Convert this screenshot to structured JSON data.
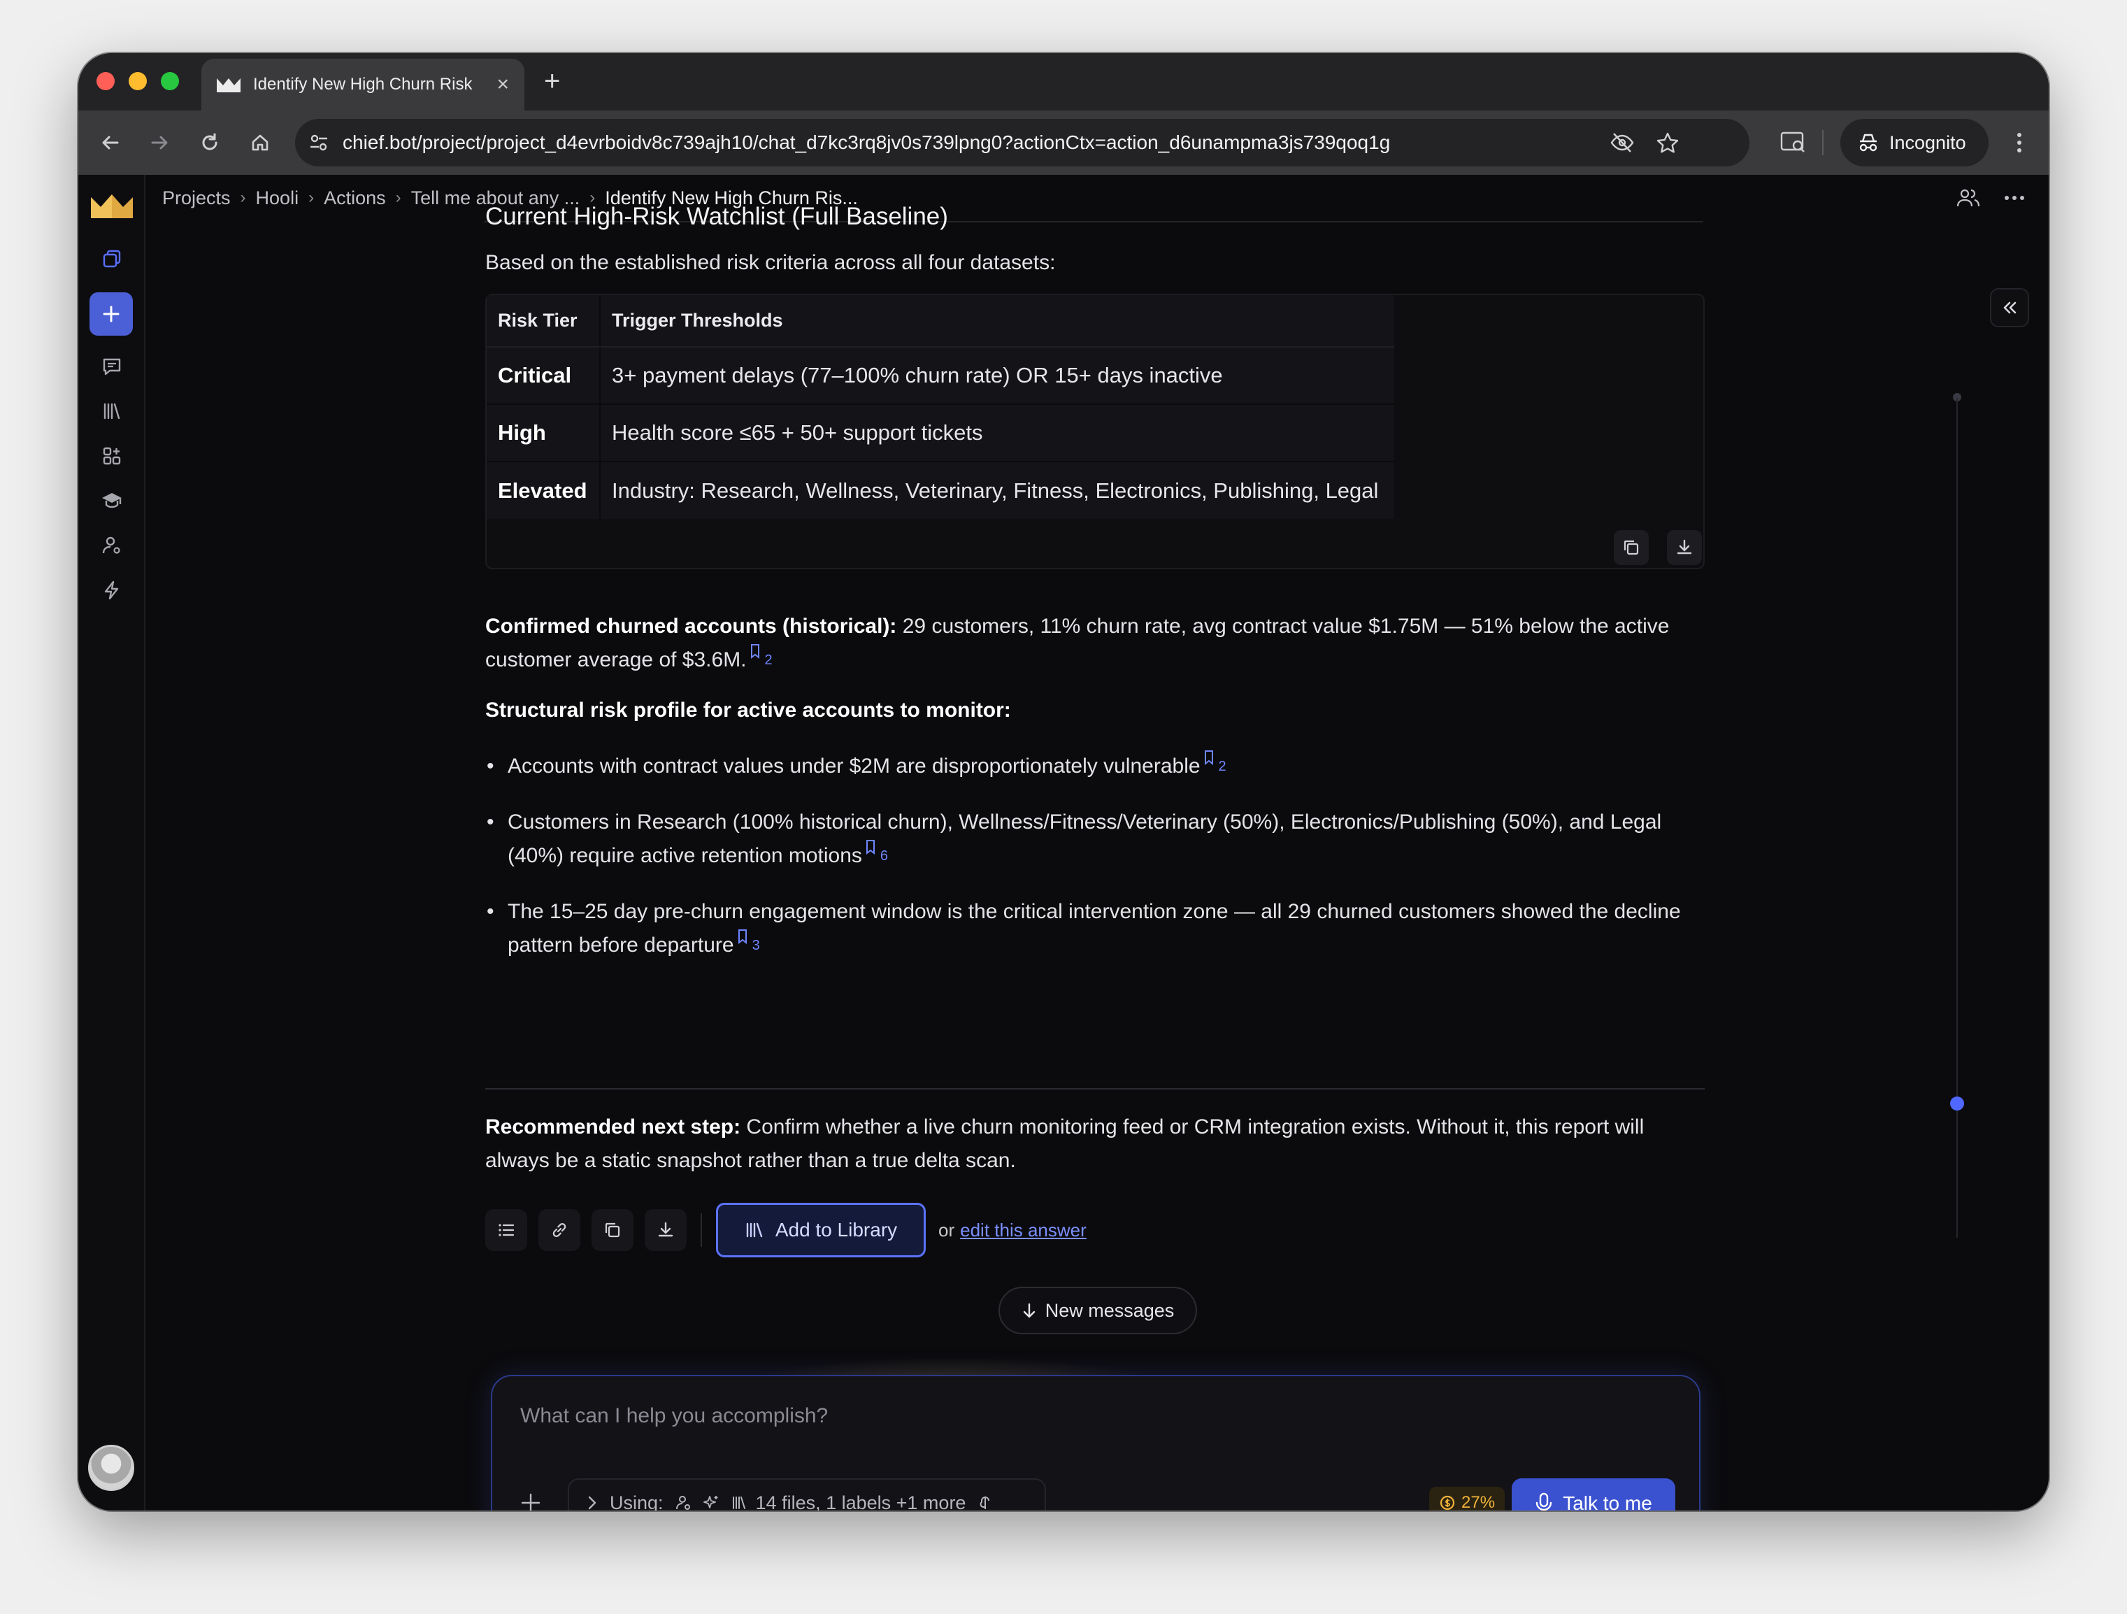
{
  "browser": {
    "tab_title": "Identify New High Churn Risk",
    "url": "chief.bot/project/project_d4evrboidv8c739ajh10/chat_d7kc3rq8jv0s739lpng0?actionCtx=action_d6unampma3js739qoq1g",
    "incognito_label": "Incognito",
    "traffic_colors": [
      "#ff5f57",
      "#febc2e",
      "#28c840"
    ]
  },
  "breadcrumb": {
    "items": [
      "Projects",
      "Hooli",
      "Actions",
      "Tell me about any ...",
      "Identify New High Churn Ris..."
    ]
  },
  "content": {
    "heading": "Current High-Risk Watchlist (Full Baseline)",
    "intro": "Based on the established risk criteria across all four datasets:",
    "table": {
      "headers": [
        "Risk Tier",
        "Trigger Thresholds"
      ],
      "rows": [
        {
          "tier": "Critical",
          "threshold": "3+ payment delays (77–100% churn rate) OR 15+ days inactive"
        },
        {
          "tier": "High",
          "threshold": "Health score ≤65 + 50+ support tickets"
        },
        {
          "tier": "Elevated",
          "threshold": "Industry: Research, Wellness, Veterinary, Fitness, Electronics, Publishing, Legal"
        }
      ]
    },
    "confirmed_bold": "Confirmed churned accounts (historical):",
    "confirmed_text": " 29 customers, 11% churn rate, avg contract value $1.75M — 51% below the active customer average of $3.6M.",
    "confirmed_cite": "2",
    "structural_heading": "Structural risk profile for active accounts to monitor:",
    "bullets": [
      {
        "text": "Accounts with contract values under $2M are disproportionately vulnerable",
        "cite": "2"
      },
      {
        "text": "Customers in Research (100% historical churn), Wellness/Fitness/Veterinary (50%), Electronics/Publishing (50%), and Legal (40%) require active retention motions",
        "cite": "6"
      },
      {
        "text": "The 15–25 day pre-churn engagement window is the critical intervention zone — all 29 churned customers showed the decline pattern before departure",
        "cite": "3"
      }
    ],
    "next_step_bold": "Recommended next step:",
    "next_step_text": " Confirm whether a live churn monitoring feed or CRM integration exists. Without it, this report will always be a static snapshot rather than a true delta scan."
  },
  "actions": {
    "add_library_label": "Add to Library",
    "or_text": "or",
    "edit_link": "edit this answer"
  },
  "new_messages_label": "New messages",
  "composer": {
    "placeholder": "What can I help you accomplish?",
    "using_label": "Using:",
    "files_label": "14 files, 1 labels +1 more",
    "credits": "27%",
    "talk_label": "Talk to me"
  },
  "colors": {
    "accent": "#4b5fd6",
    "link": "#7b8fff",
    "credits": "#f0b23a"
  }
}
